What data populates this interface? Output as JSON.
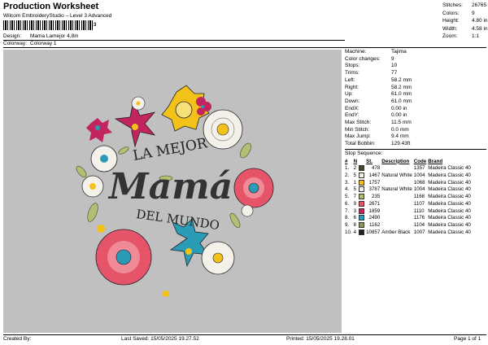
{
  "header": {
    "title": "Production Worksheet",
    "subtitle": "Wilcom EmbroideryStudio – Level 3 Advanced",
    "barcode_suffix": "3"
  },
  "design": {
    "label": "Design:",
    "value": "Mama Lamejor 4,8in"
  },
  "colorway": {
    "label": "Colorway:",
    "value": "Colorway 1"
  },
  "stats": [
    {
      "k": "Stitches:",
      "v": "26765"
    },
    {
      "k": "Colors:",
      "v": "9"
    },
    {
      "k": "Height:",
      "v": "4.80 in"
    },
    {
      "k": "Width:",
      "v": "4.58 in"
    },
    {
      "k": "Zoom:",
      "v": "1:1"
    }
  ],
  "machine": [
    {
      "k": "Machine:",
      "v": "Tajima"
    },
    {
      "k": "Color changes:",
      "v": "9"
    },
    {
      "k": "Stops:",
      "v": "10"
    },
    {
      "k": "Trims:",
      "v": "77"
    },
    {
      "k": "Left:",
      "v": "58.2 mm"
    },
    {
      "k": "Right:",
      "v": "58.2 mm"
    },
    {
      "k": "Up:",
      "v": "61.0 mm"
    },
    {
      "k": "Down:",
      "v": "61.0 mm"
    },
    {
      "k": "EndX:",
      "v": "0.00 in"
    },
    {
      "k": "EndY:",
      "v": "0.00 in"
    },
    {
      "k": "Max Stitch:",
      "v": "11.5 mm"
    },
    {
      "k": "Min Stitch:",
      "v": "0.0 mm"
    },
    {
      "k": "Max Jump:",
      "v": "9.4 mm"
    },
    {
      "k": "Total Bobbin:",
      "v": "129.43ft"
    }
  ],
  "stop_sequence": {
    "title": "Stop Sequence:",
    "headers": [
      "#",
      "N",
      "St.",
      "Description",
      "Code",
      "Brand"
    ],
    "rows": [
      {
        "num": "1.",
        "n": "2",
        "color": "#3d4a2a",
        "st": "478",
        "desc": "",
        "code": "1357",
        "brand": "Madeira Classic 40"
      },
      {
        "num": "2.",
        "n": "5",
        "color": "#f4f1ea",
        "st": "1467",
        "desc": "Natural White",
        "code": "1004",
        "brand": "Madeira Classic 40"
      },
      {
        "num": "3.",
        "n": "1",
        "color": "#f2c21b",
        "st": "1757",
        "desc": "",
        "code": "1068",
        "brand": "Madeira Classic 40"
      },
      {
        "num": "4.",
        "n": "5",
        "color": "#f4f1ea",
        "st": "3787",
        "desc": "Natural White",
        "code": "1004",
        "brand": "Madeira Classic 40"
      },
      {
        "num": "5.",
        "n": "7",
        "color": "#b5bd72",
        "st": "235",
        "desc": "",
        "code": "1168",
        "brand": "Madeira Classic 40"
      },
      {
        "num": "6.",
        "n": "9",
        "color": "#e6546a",
        "st": "2671",
        "desc": "",
        "code": "1107",
        "brand": "Madeira Classic 40"
      },
      {
        "num": "7.",
        "n": "3",
        "color": "#c1245e",
        "st": "1859",
        "desc": "",
        "code": "1110",
        "brand": "Madeira Classic 40"
      },
      {
        "num": "8.",
        "n": "6",
        "color": "#2a9cb8",
        "st": "2490",
        "desc": "",
        "code": "1176",
        "brand": "Madeira Classic 40"
      },
      {
        "num": "9.",
        "n": "8",
        "color": "#8e9560",
        "st": "1162",
        "desc": "",
        "code": "1104",
        "brand": "Madeira Classic 40"
      },
      {
        "num": "10.",
        "n": "4",
        "color": "#222222",
        "st": "10857",
        "desc": "Amber Black",
        "code": "1007",
        "brand": "Madeira Classic 40"
      }
    ]
  },
  "artwork": {
    "line1": "LA MEJOR",
    "line2": "Mamá",
    "line3": "DEL MUNDO"
  },
  "footer": {
    "created_by": "Created By:",
    "last_saved": "Last Saved: 15/05/2025 19.27.52",
    "printed": "Printed: 15/05/2025 19.28.01",
    "page": "Page 1 of 1"
  }
}
